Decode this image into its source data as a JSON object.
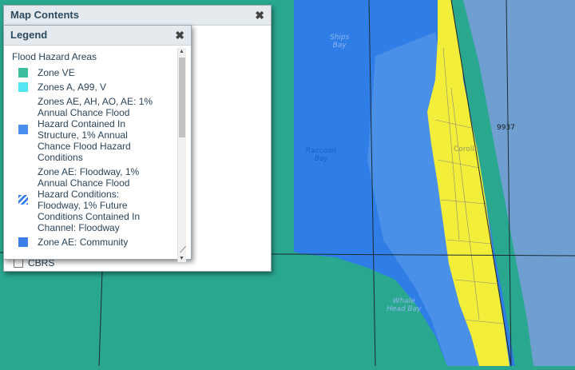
{
  "map_contents": {
    "title": "Map Contents"
  },
  "legend": {
    "title": "Legend",
    "heading": "Flood Hazard Areas",
    "items": [
      {
        "label": "Zone VE",
        "color": "#3bbd9e",
        "pattern": "solid"
      },
      {
        "label": "Zones A, A99, V",
        "color": "#52e6f2",
        "pattern": "solid"
      },
      {
        "label": "Zones AE, AH, AO, AE: 1% Annual Chance Flood Hazard Contained In Structure, 1% Annual Chance Flood Hazard Conditions",
        "color": "#4a8ff0",
        "pattern": "solid"
      },
      {
        "label": "Zone AE: Floodway, 1% Annual Chance Flood Hazard Conditions: Floodway, 1% Future Conditions Contained In Channel: Floodway",
        "color": "#3b7ee8",
        "pattern": "hatched"
      },
      {
        "label": "Zone AE: Community",
        "color": "#3b7ee8",
        "pattern": "solid"
      }
    ]
  },
  "layer_cbrs": {
    "label": "CBRS",
    "checked": false
  },
  "map_labels": {
    "ships_bay": "Ships\nBay",
    "raccoon_bay": "Raccoon\nBay",
    "whale_head_bay": "Whale\nHead Bay",
    "parcel_number": "9937",
    "town": "Corolla"
  },
  "colors": {
    "zone_ve_water": "#2aa88f",
    "zone_ae_water": "#2f7de6",
    "zone_ae_light": "#4a8fe8",
    "shade_x": "#f2ee3a",
    "ocean": "#6f9fd1"
  }
}
